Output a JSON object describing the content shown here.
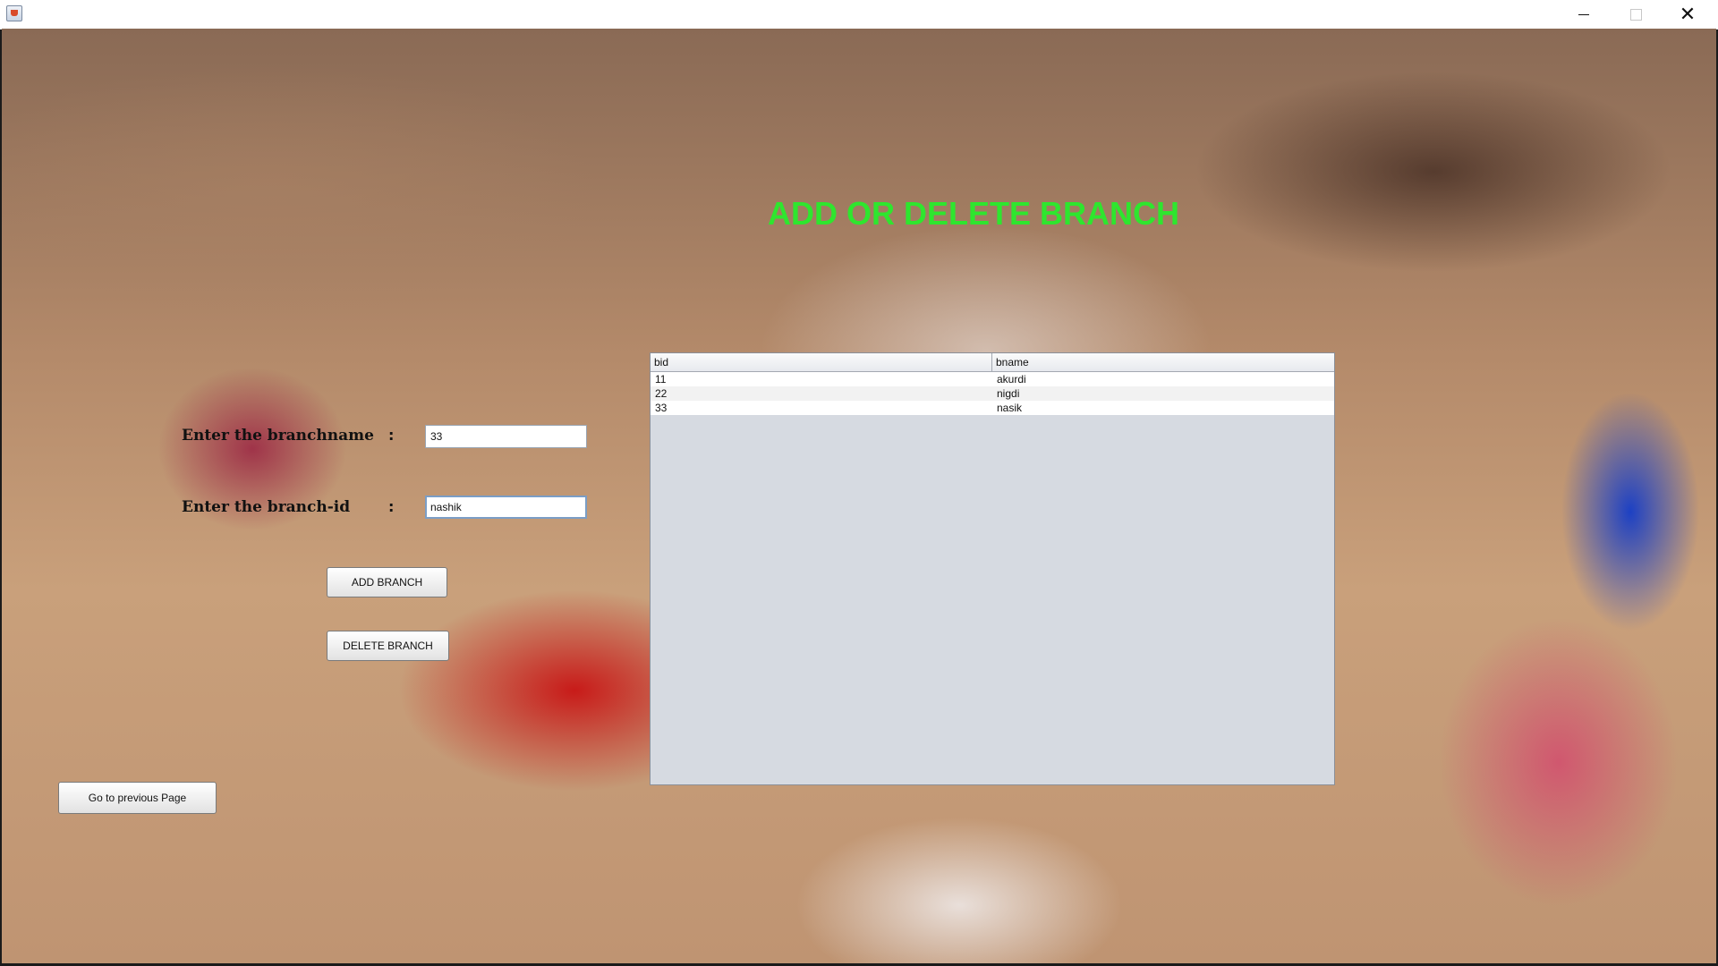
{
  "window": {
    "title": "",
    "controls": {
      "minimize_icon": "minimize-icon",
      "maximize_icon": "maximize-icon",
      "close_icon": "close-icon",
      "close_glyph": "✕"
    }
  },
  "page": {
    "title": "ADD OR DELETE BRANCH",
    "title_color": "#2ee62e"
  },
  "form": {
    "branchname_label": "Enter the branchname",
    "branchname_colon": ":",
    "branchname_value": "33",
    "branchid_label": "Enter the branch-id",
    "branchid_colon": ":",
    "branchid_value": "nashik",
    "add_button": "ADD BRANCH",
    "delete_button": "DELETE BRANCH"
  },
  "nav": {
    "back_button": "Go to previous Page"
  },
  "table": {
    "columns": [
      "bid",
      "bname"
    ],
    "rows": [
      [
        "11",
        "akurdi"
      ],
      [
        "22",
        "nigdi"
      ],
      [
        "33",
        "nasik"
      ]
    ]
  }
}
